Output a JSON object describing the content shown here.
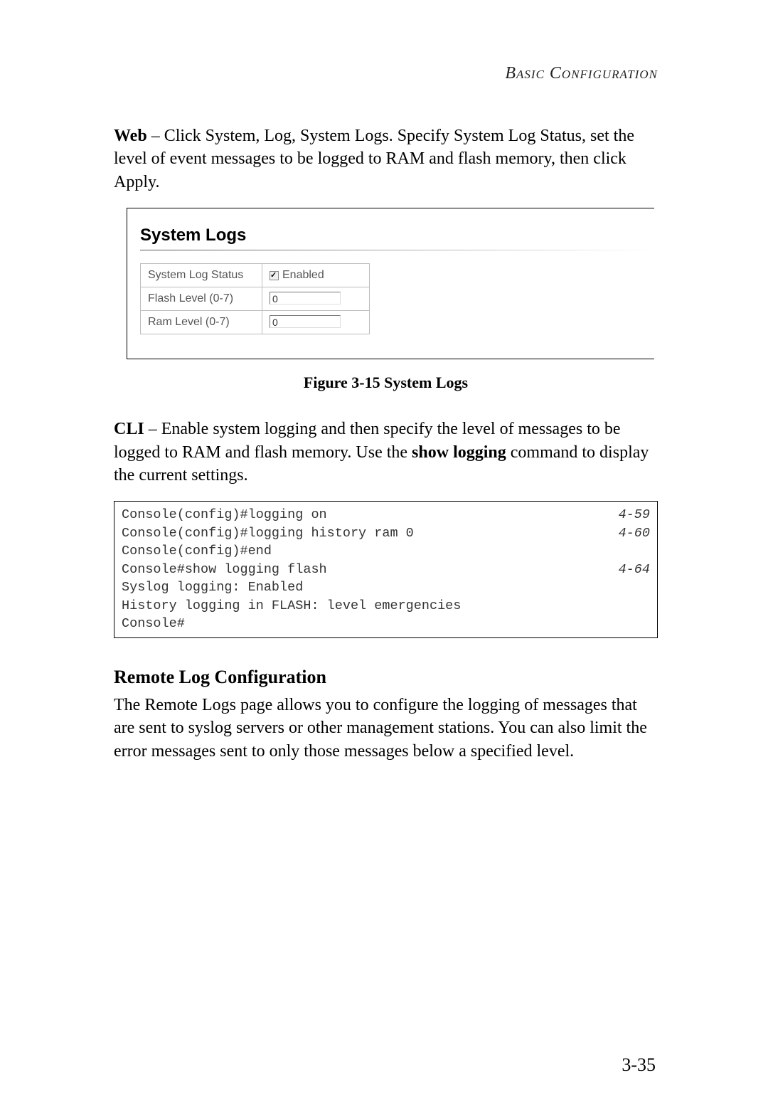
{
  "header": {
    "running_title": "Basic Configuration"
  },
  "paragraphs": {
    "web_lead": "Web",
    "web_text": " – Click System, Log, System Logs. Specify System Log Status, set the level of event messages to be logged to RAM and flash memory, then click Apply.",
    "cli_lead": "CLI",
    "cli_text_part1": " – Enable system logging and then specify the level of messages to be logged to RAM and flash memory. Use the ",
    "cli_bold": "show logging",
    "cli_text_part2": " command to display the current settings.",
    "remote_text": "The Remote Logs page allows you to configure the logging of messages that are sent to syslog servers or other management stations. You can also limit the error messages sent to only those messages below a specified level."
  },
  "figure": {
    "title": "System Logs",
    "rows": {
      "status_label": "System Log Status",
      "status_value": "Enabled",
      "flash_label": "Flash Level (0-7)",
      "flash_value": "0",
      "ram_label": "Ram Level (0-7)",
      "ram_value": "0"
    },
    "caption": "Figure 3-15  System Logs"
  },
  "cli": {
    "l1": "Console(config)#logging on",
    "r1": "4-59",
    "l2": "Console(config)#logging history ram 0",
    "r2": "4-60",
    "l3": "Console(config)#end",
    "l4": "Console#show logging flash",
    "r4": "4-64",
    "l5": "Syslog logging: Enabled",
    "l6": "History logging in FLASH: level emergencies",
    "l7": "Console#"
  },
  "section": {
    "remote_heading": "Remote Log Configuration"
  },
  "footer": {
    "page_number": "3-35"
  }
}
